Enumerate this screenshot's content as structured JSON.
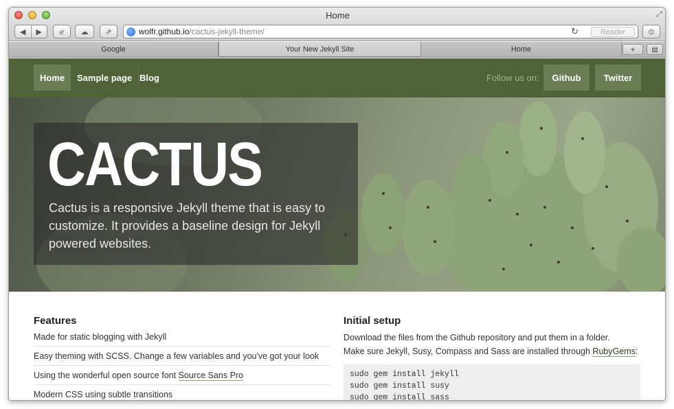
{
  "browser": {
    "window_title": "Home",
    "url_host": "wolfr.github.io",
    "url_path": "/cactus-jekyll-theme/",
    "reader_label": "Reader",
    "tabs": [
      {
        "label": "Google",
        "active": false
      },
      {
        "label": "Your New Jekyll Site",
        "active": true
      },
      {
        "label": "Home",
        "active": false
      }
    ],
    "icons": [
      "back-icon",
      "forward-icon",
      "ie-icon",
      "cloud-icon",
      "share-icon",
      "globe-icon",
      "reload-icon",
      "download-icon",
      "fullscreen-icon",
      "add-tab-icon",
      "tab-list-icon"
    ]
  },
  "site": {
    "nav": {
      "items": [
        {
          "label": "Home",
          "active": true
        },
        {
          "label": "Sample page",
          "active": false
        },
        {
          "label": "Blog",
          "active": false
        }
      ],
      "follow_label": "Follow us on:",
      "social": [
        {
          "label": "Github"
        },
        {
          "label": "Twitter"
        }
      ]
    },
    "hero": {
      "title": "CACTUS",
      "text": "Cactus is a responsive Jekyll theme that is easy to customize. It provides a baseline design for Jekyll powered websites."
    },
    "features": {
      "heading": "Features",
      "items": [
        {
          "text": "Made for static blogging with Jekyll"
        },
        {
          "text": "Easy theming with SCSS. Change a few variables and you've got your look"
        },
        {
          "text_before": "Using the wonderful open source font ",
          "link": "Source Sans Pro"
        },
        {
          "text": "Modern CSS using subtle transitions"
        }
      ]
    },
    "setup": {
      "heading": "Initial setup",
      "line1": "Download the files from the Github repository and put them in a folder.",
      "line2_before": "Make sure Jekyll, Susy, Compass and Sass are installed through ",
      "line2_link": "RubyGems",
      "line2_after": ":",
      "code": [
        "sudo gem install jekyll",
        "sudo gem install susy",
        "sudo gem install sass"
      ]
    },
    "colors": {
      "nav_bg": "#4f6238",
      "nav_active": "#6a7d55",
      "follow_text": "#a3b38c"
    }
  }
}
